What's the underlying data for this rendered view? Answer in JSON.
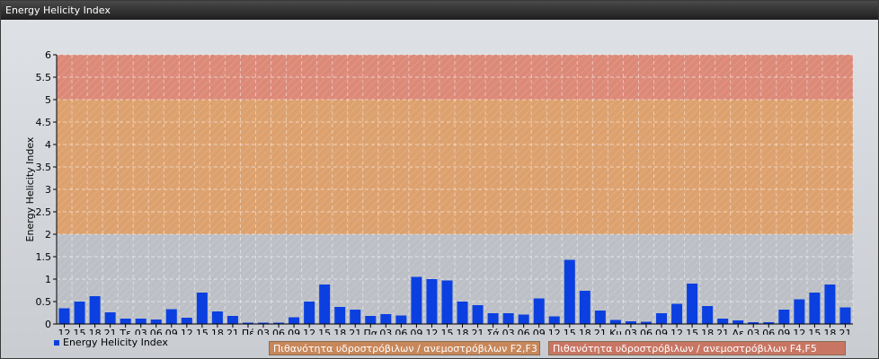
{
  "window": {
    "title": "Energy Helicity Index"
  },
  "legend": {
    "series_label": "Energy Helicity Index",
    "series_color": "#0b3fe0"
  },
  "bands": [
    {
      "label": "Πιθανότητα υδροστρόβιλων / ανεμοστρόβιλων F2,F3",
      "from": 2,
      "to": 5,
      "color": "#e39b5e"
    },
    {
      "label": "Πιθανότητα υδροστρόβιλων / ανεμοστρόβιλων F4,F5",
      "from": 5,
      "to": 6,
      "color": "#e27f6a"
    }
  ],
  "chart_data": {
    "type": "bar",
    "ylabel": "Energy Helicity Index",
    "ylim": [
      0,
      6
    ],
    "yticks": [
      "0",
      "0.5",
      "1",
      "1.5",
      "2",
      "2.5",
      "3",
      "3.5",
      "4",
      "4.5",
      "5",
      "5.5",
      "6"
    ],
    "categories": [
      "12",
      "15",
      "18",
      "21",
      "Τε",
      "03",
      "06",
      "09",
      "12",
      "15",
      "18",
      "21",
      "Πέ",
      "03",
      "06",
      "09",
      "12",
      "15",
      "18",
      "21",
      "Πα",
      "03",
      "06",
      "09",
      "12",
      "15",
      "18",
      "21",
      "Σά",
      "03",
      "06",
      "09",
      "12",
      "15",
      "18",
      "21",
      "Κυ",
      "03",
      "06",
      "09",
      "12",
      "15",
      "18",
      "21",
      "Δε",
      "03",
      "06",
      "09",
      "12",
      "15",
      "18",
      "21"
    ],
    "series": [
      {
        "name": "Energy Helicity Index",
        "color": "#0b3fe0",
        "values": [
          0.35,
          0.5,
          0.62,
          0.26,
          0.12,
          0.12,
          0.1,
          0.33,
          0.14,
          0.7,
          0.28,
          0.18,
          0.03,
          0.03,
          0.03,
          0.15,
          0.5,
          0.88,
          0.38,
          0.32,
          0.18,
          0.22,
          0.19,
          1.05,
          1.0,
          0.97,
          0.5,
          0.42,
          0.24,
          0.24,
          0.21,
          0.57,
          0.17,
          1.43,
          0.74,
          0.3,
          0.09,
          0.06,
          0.05,
          0.24,
          0.45,
          0.9,
          0.4,
          0.12,
          0.08,
          0.04,
          0.04,
          0.32,
          0.55,
          0.7,
          0.88,
          0.37
        ]
      }
    ],
    "grid": true
  }
}
